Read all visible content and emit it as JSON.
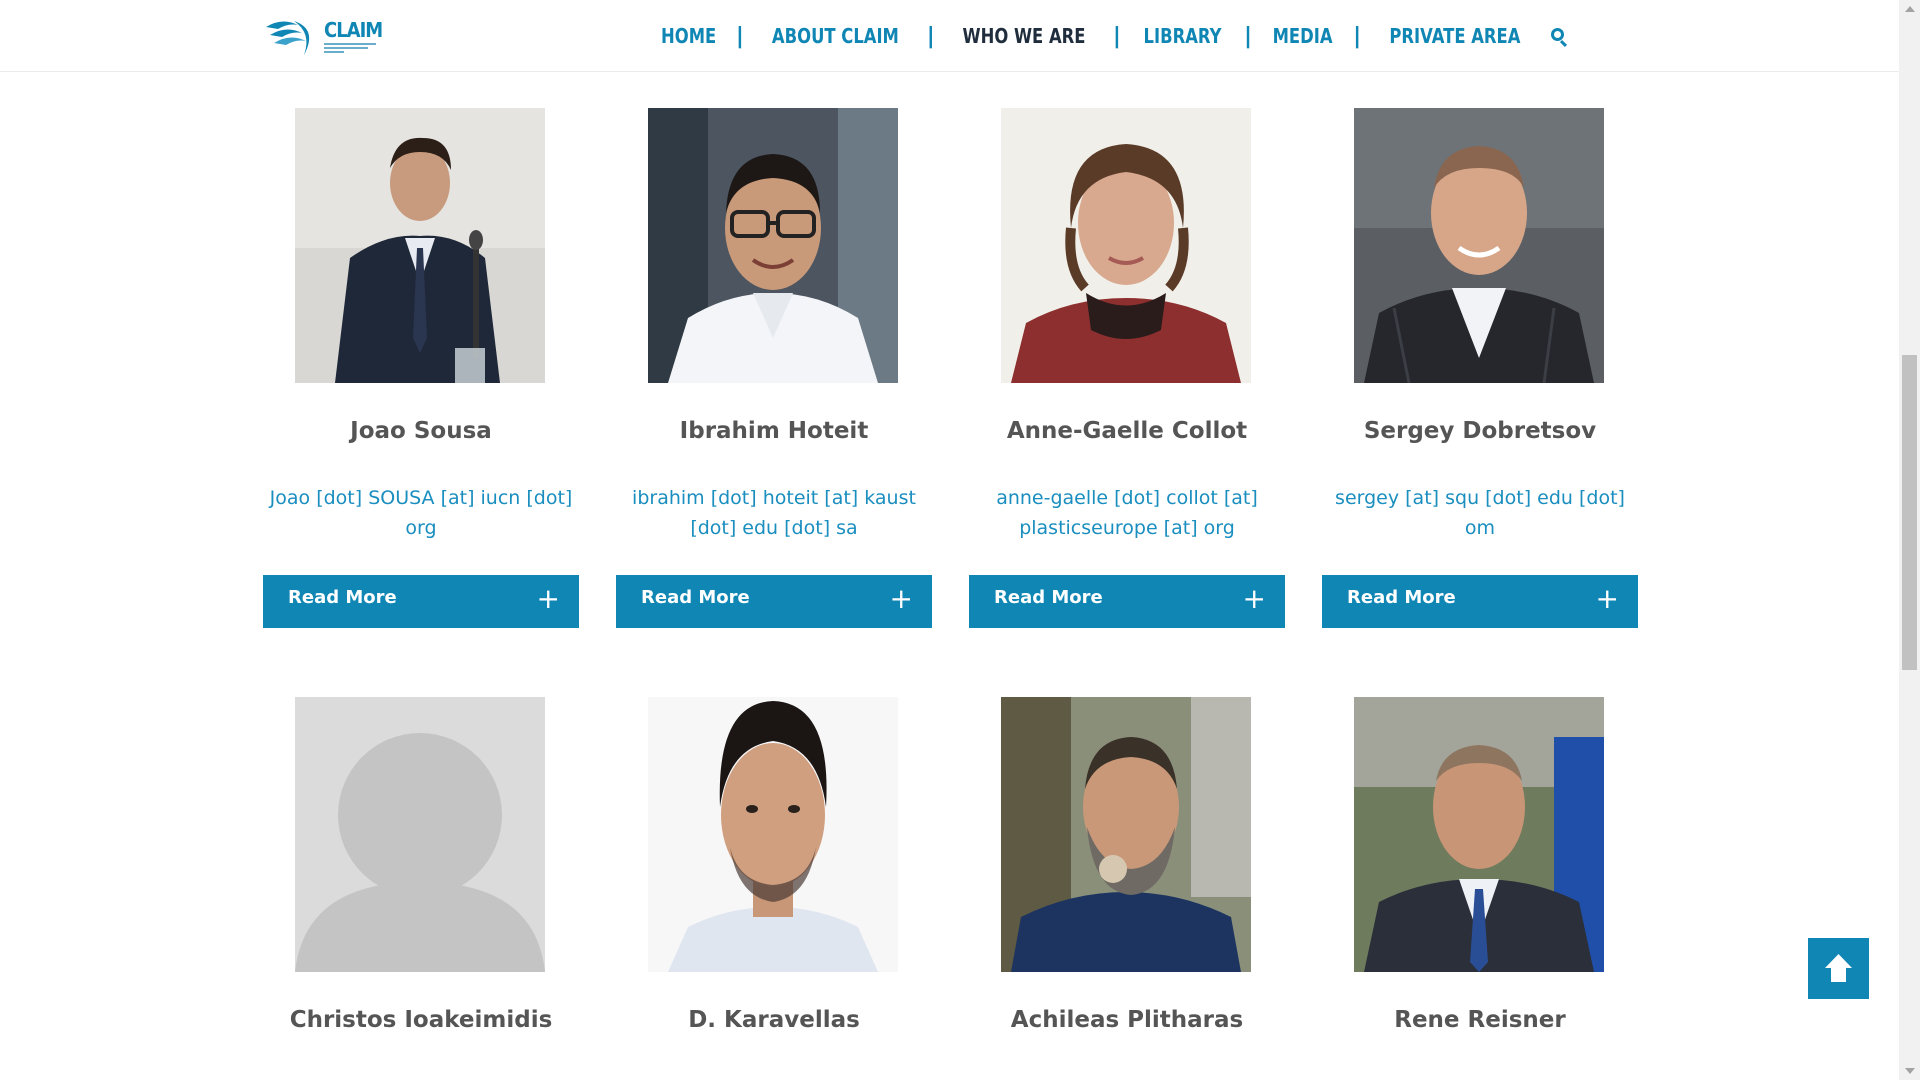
{
  "header": {
    "logo_text": "CLAIM",
    "nav": [
      {
        "label": "HOME"
      },
      {
        "label": "ABOUT CLAIM"
      },
      {
        "label": "WHO WE ARE"
      },
      {
        "label": "LIBRARY"
      },
      {
        "label": "MEDIA"
      },
      {
        "label": "PRIVATE AREA"
      }
    ],
    "active_index": 2
  },
  "team": [
    {
      "name": "Joao Sousa",
      "email": "Joao [dot] SOUSA [at] iucn [dot] org",
      "button": "Read More"
    },
    {
      "name": "Ibrahim Hoteit",
      "email": "ibrahim [dot] hoteit [at] kaust [dot] edu [dot] sa",
      "button": "Read More"
    },
    {
      "name": "Anne-Gaelle Collot",
      "email": "anne-gaelle [dot] collot [at] plasticseurope [at] org",
      "button": "Read More"
    },
    {
      "name": "Sergey Dobretsov",
      "email": "sergey [at] squ [dot] edu [dot] om",
      "button": "Read More"
    },
    {
      "name": "Christos Ioakeimidis"
    },
    {
      "name": "D. Karavellas"
    },
    {
      "name": "Achileas Plitharas"
    },
    {
      "name": "Rene Reisner"
    }
  ],
  "colors": {
    "accent": "#0f86b4",
    "nav_active": "#1f2d3d",
    "name": "#555555",
    "email": "#1a8ebf"
  },
  "icons": {
    "search": "search-icon",
    "plus": "plus-icon",
    "back_to_top": "arrow-up-icon"
  }
}
